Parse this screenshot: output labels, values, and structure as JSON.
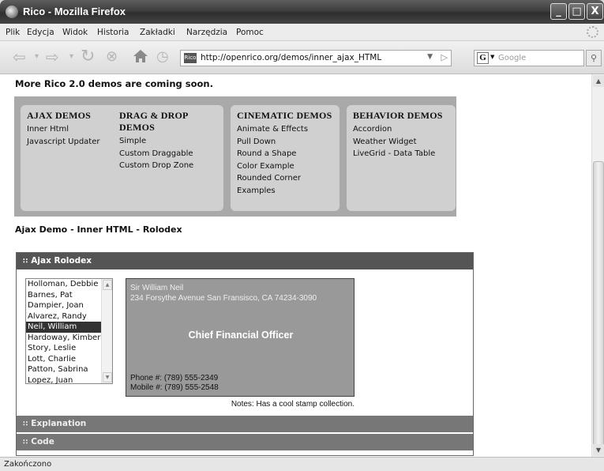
{
  "window": {
    "title": "Rico - Mozilla Firefox",
    "minimize": "_",
    "maximize": "□",
    "close": "X"
  },
  "menu": [
    "Plik",
    "Edycja",
    "Widok",
    "Historia",
    "Zakładki",
    "Narzędzia",
    "Pomoc"
  ],
  "nav": {
    "url": "http://openrico.org/demos/inner_ajax_HTML",
    "favicon": "Rico",
    "search_placeholder": "Google",
    "search_engine": "G",
    "icons": [
      "back-icon",
      "forward-icon",
      "reload-icon",
      "stop-icon",
      "home-icon",
      "history-icon",
      "search-icon"
    ]
  },
  "page": {
    "intro": "More Rico 2.0 demos are coming soon.",
    "demo_groups": [
      {
        "title": "AJAX DEMOS",
        "links": [
          "Inner Html",
          "Javascript Updater"
        ]
      },
      {
        "title": "DRAG & DROP DEMOS",
        "links": [
          "Simple",
          "Custom Draggable",
          "Custom Drop Zone"
        ]
      },
      {
        "title": "CINEMATIC DEMOS",
        "links": [
          "Animate & Effects",
          "Pull Down",
          "Round a Shape",
          "Color Example",
          "Rounded Corner Examples"
        ]
      },
      {
        "title": "BEHAVIOR DEMOS",
        "links": [
          "Accordion",
          "Weather Widget",
          "LiveGrid - Data Table"
        ]
      }
    ],
    "section_title": "Ajax Demo - Inner HTML - Rolodex",
    "accordion": {
      "panels": [
        "Ajax Rolodex",
        "Explanation",
        "Code"
      ],
      "grip": "∷"
    },
    "rolodex": {
      "people": [
        "Holloman, Debbie",
        "Barnes, Pat",
        "Dampier, Joan",
        "Alvarez, Randy",
        "Neil, William",
        "Hardoway, Kimber",
        "Story, Leslie",
        "Lott, Charlie",
        "Patton, Sabrina",
        "Lopez, Juan"
      ],
      "selected_index": 4,
      "card": {
        "name": "Sir William Neil",
        "address": "234 Forsythe Avenue San Fransisco, CA 74234-3090",
        "role": "Chief Financial Officer",
        "phone": "Phone #: (789) 555-2349",
        "mobile": "Mobile #: (789) 555-2548"
      },
      "notes": "Notes: Has a cool stamp collection."
    }
  },
  "status": "Zakończono",
  "colors": {
    "demo_bg": "#a9a9a9",
    "demo_col": "#d0d0d0",
    "accordion_head": "#555555",
    "card_bg": "#999999"
  }
}
